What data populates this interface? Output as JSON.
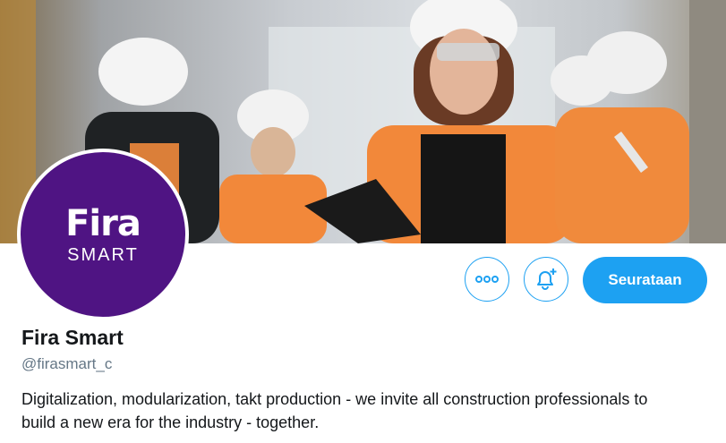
{
  "profile": {
    "avatar_text_main": "Fira",
    "avatar_text_sub": "SMART",
    "name": "Fira Smart",
    "handle": "@firasmart_c",
    "bio": "Digitalization, modularization, takt production - we invite all construction professionals to build a new era for the industry - together."
  },
  "actions": {
    "more_icon": "more-icon",
    "notify_icon": "bell-plus-icon",
    "follow_label": "Seurataan"
  },
  "colors": {
    "accent": "#1da1f2",
    "brand_purple": "#4f1483",
    "vest_orange": "#f2883a"
  }
}
